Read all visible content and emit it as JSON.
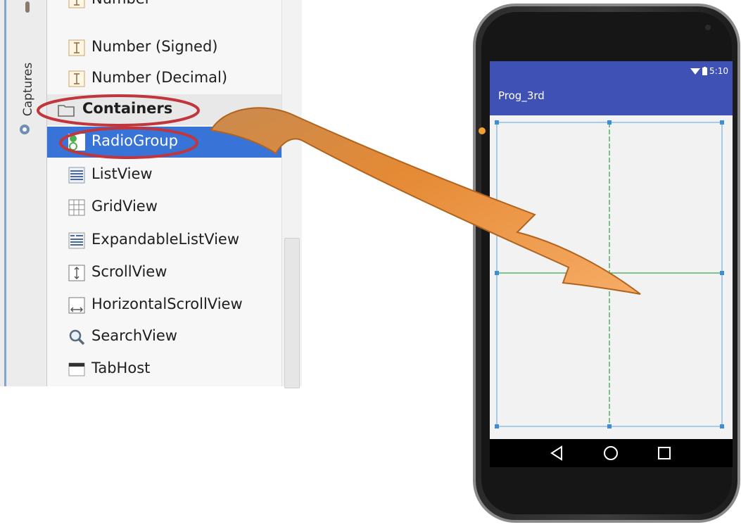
{
  "palette": {
    "items": [
      {
        "label": "Number",
        "icon": "text-field-icon"
      },
      {
        "label": "Number (Signed)",
        "icon": "text-field-icon"
      },
      {
        "label": "Number (Decimal)",
        "icon": "text-field-icon"
      },
      {
        "label": "Containers",
        "icon": "folder-icon",
        "category": true
      },
      {
        "label": "RadioGroup",
        "icon": "radiogroup-icon",
        "selected": true
      },
      {
        "label": "ListView",
        "icon": "listview-icon"
      },
      {
        "label": "GridView",
        "icon": "gridview-icon"
      },
      {
        "label": "ExpandableListView",
        "icon": "expandablelist-icon"
      },
      {
        "label": "ScrollView",
        "icon": "scrollview-icon"
      },
      {
        "label": "HorizontalScrollView",
        "icon": "horizontal-scroll-icon"
      },
      {
        "label": "SearchView",
        "icon": "search-icon"
      },
      {
        "label": "TabHost",
        "icon": "tabhost-icon"
      }
    ]
  },
  "side_tab": {
    "label": "Captures"
  },
  "phone": {
    "status_time": "5:10",
    "app_title": "Prog_3rd"
  },
  "colors": {
    "selection": "#3874d8",
    "highlight_ellipse": "#c0363c",
    "arrow": "#f0913c",
    "app_bar": "#3f51b5"
  }
}
